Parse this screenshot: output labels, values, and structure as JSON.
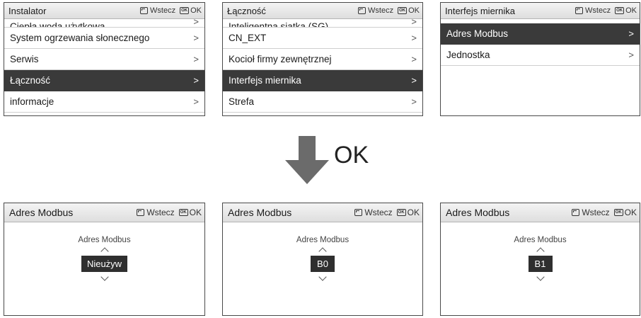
{
  "nav": {
    "back_label": "Wstecz",
    "ok_label": "OK",
    "ok_icon_text": "OK"
  },
  "top_screens": [
    {
      "title": "Instalator",
      "items": [
        {
          "label": "Ciepła woda użytkowa",
          "chevron": ">"
        },
        {
          "label": "System ogrzewania słonecznego",
          "chevron": ">"
        },
        {
          "label": "Serwis",
          "chevron": ">"
        },
        {
          "label": "Łączność",
          "chevron": ">"
        },
        {
          "label": "informacje",
          "chevron": ">"
        }
      ],
      "selected_index": 3
    },
    {
      "title": "Łączność",
      "items": [
        {
          "label": "Inteligentna siatka (SG)",
          "chevron": ">"
        },
        {
          "label": "CN_EXT",
          "chevron": ">"
        },
        {
          "label": "Kocioł firmy zewnętrznej",
          "chevron": ">"
        },
        {
          "label": "Interfejs miernika",
          "chevron": ">"
        },
        {
          "label": "Strefa",
          "chevron": ">"
        }
      ],
      "selected_index": 3
    },
    {
      "title": "Interfejs miernika",
      "items": [
        {
          "label": "Adres Modbus",
          "chevron": ">"
        },
        {
          "label": "Jednostka",
          "chevron": ">"
        }
      ],
      "selected_index": 0
    }
  ],
  "transition": {
    "label": "OK"
  },
  "bottom_screens": [
    {
      "title": "Adres Modbus",
      "caption": "Adres Modbus",
      "value": "Nieużyw"
    },
    {
      "title": "Adres Modbus",
      "caption": "Adres Modbus",
      "value": "B0"
    },
    {
      "title": "Adres Modbus",
      "caption": "Adres Modbus",
      "value": "B1"
    }
  ]
}
